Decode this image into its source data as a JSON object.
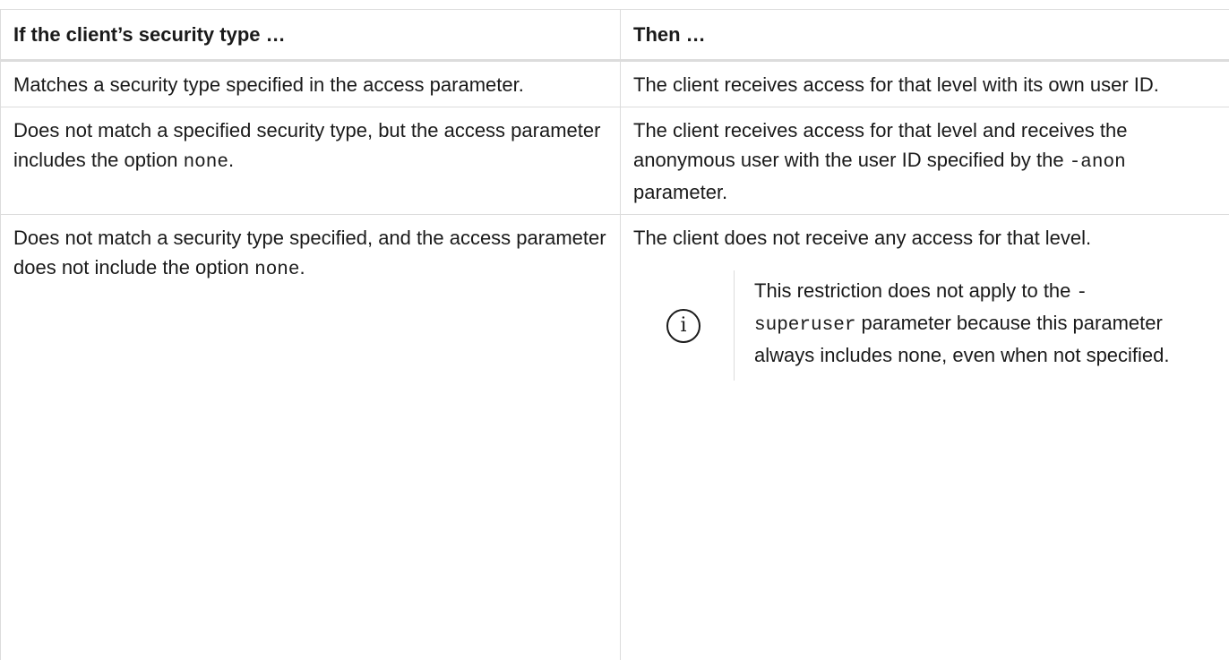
{
  "header": {
    "col1": "If the client’s security type …",
    "col2": "Then …"
  },
  "rows": [
    {
      "col1_text": "Matches a security type specified in the access parameter.",
      "col2_text": "The client receives access for that level with its own user ID."
    },
    {
      "col1_pre": "Does not match a specified security type, but the access parameter includes the option ",
      "col1_code": "none",
      "col1_post": ".",
      "col2_pre": "The client receives access for that level and receives the anonymous user with the user ID specified by the ",
      "col2_code": "-anon",
      "col2_post": " parameter."
    },
    {
      "col1_pre": "Does not match a security type specified, and the access parameter does not include the option ",
      "col1_code": "none",
      "col1_post": ".",
      "col2_text": "The client does not receive any access for that level.",
      "note": {
        "icon": "info-icon",
        "pre": "This restriction does not apply to the ",
        "code": "-superuser",
        "post": " parameter because this parameter always includes none, even when not specified."
      }
    }
  ]
}
